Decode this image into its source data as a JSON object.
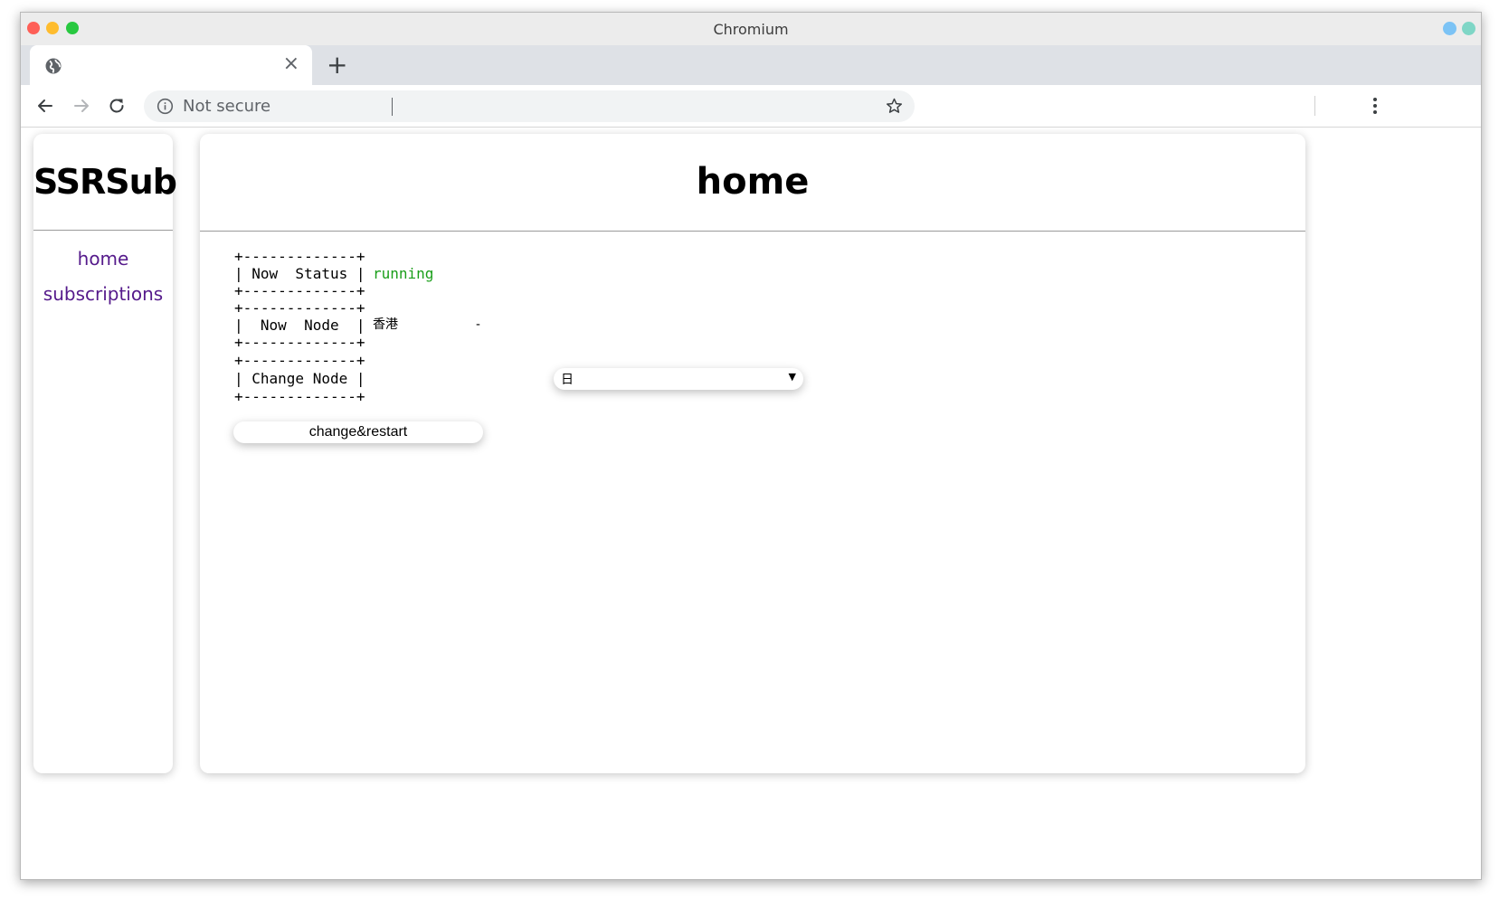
{
  "browser": {
    "window_title": "Chromium",
    "tab_close_glyph": "×",
    "new_tab_glyph": "+",
    "security_label": "Not secure",
    "icons": [
      "globe-icon",
      "back-arrow-icon",
      "forward-arrow-icon",
      "reload-icon",
      "info-icon",
      "star-icon",
      "kebab-menu-icon"
    ]
  },
  "sidebar": {
    "brand": "SSRSub",
    "items": [
      {
        "label": "home"
      },
      {
        "label": "subscriptions"
      }
    ]
  },
  "main": {
    "title": "home",
    "border_line": "+-------------+",
    "status_label": "| Now  Status |",
    "status_value": "running",
    "node_label": "|  Now  Node  |",
    "node_value": "香港          -",
    "change_label": "| Change Node |",
    "select_value": "日",
    "select_arrow": "▼",
    "button_label": "change&restart"
  },
  "colors": {
    "link": "#551a8b",
    "running": "#1a9e1a"
  }
}
